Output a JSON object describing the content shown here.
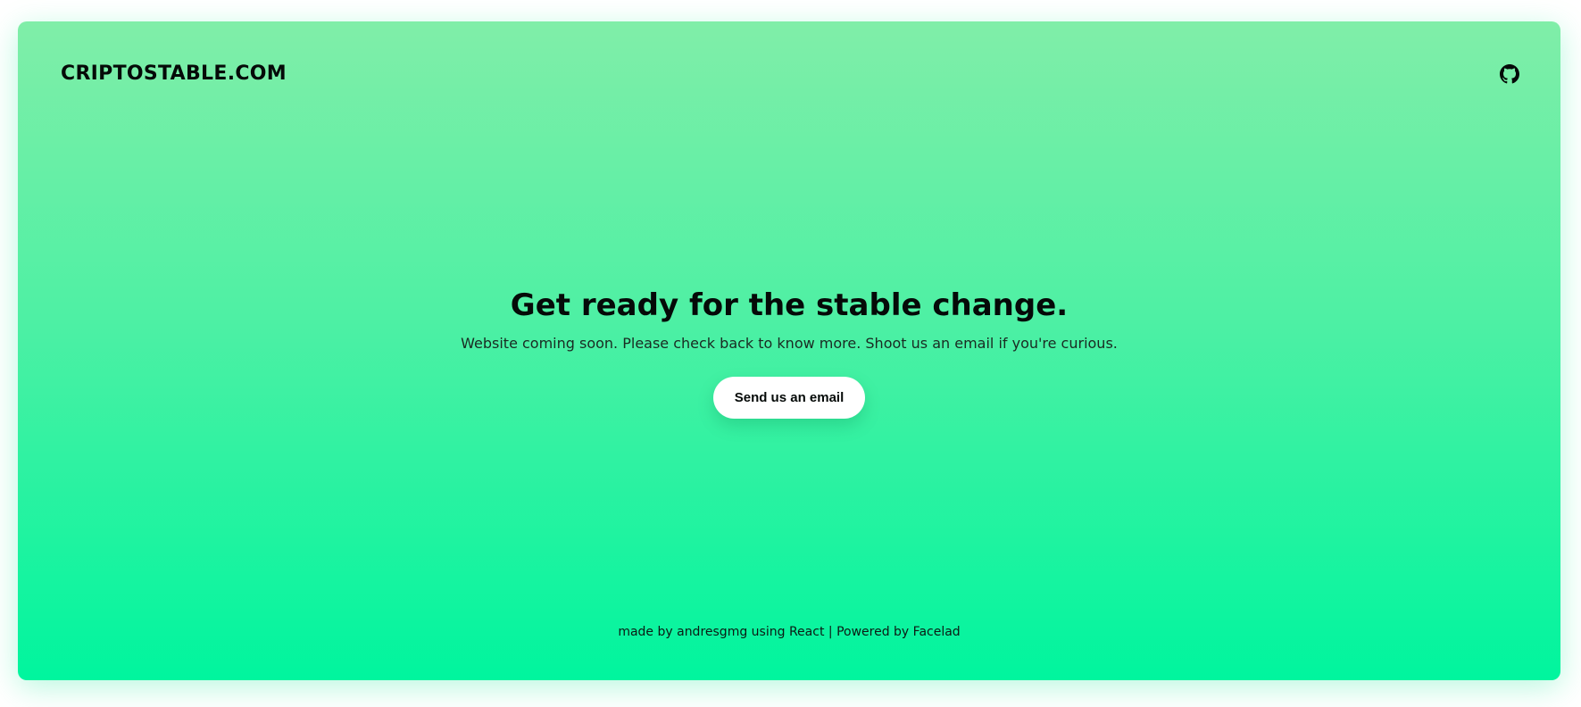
{
  "header": {
    "brand": "CRIPTOSTABLE.COM",
    "github_icon": "github-icon"
  },
  "hero": {
    "title": "Get ready for the stable change.",
    "subtitle": "Website coming soon. Please check back to know more. Shoot us an email if you're curious.",
    "cta_label": "Send us an email"
  },
  "footer": {
    "made_by": "made by",
    "author": "andresgmg",
    "using": "using",
    "tech": "React",
    "separator": "|",
    "powered_by": "Powered by",
    "powered_name": "Facelad"
  },
  "colors": {
    "gradient_top": "#80eea8",
    "gradient_bottom": "#00f59e",
    "text": "#050a08",
    "button_bg": "#ffffff"
  }
}
